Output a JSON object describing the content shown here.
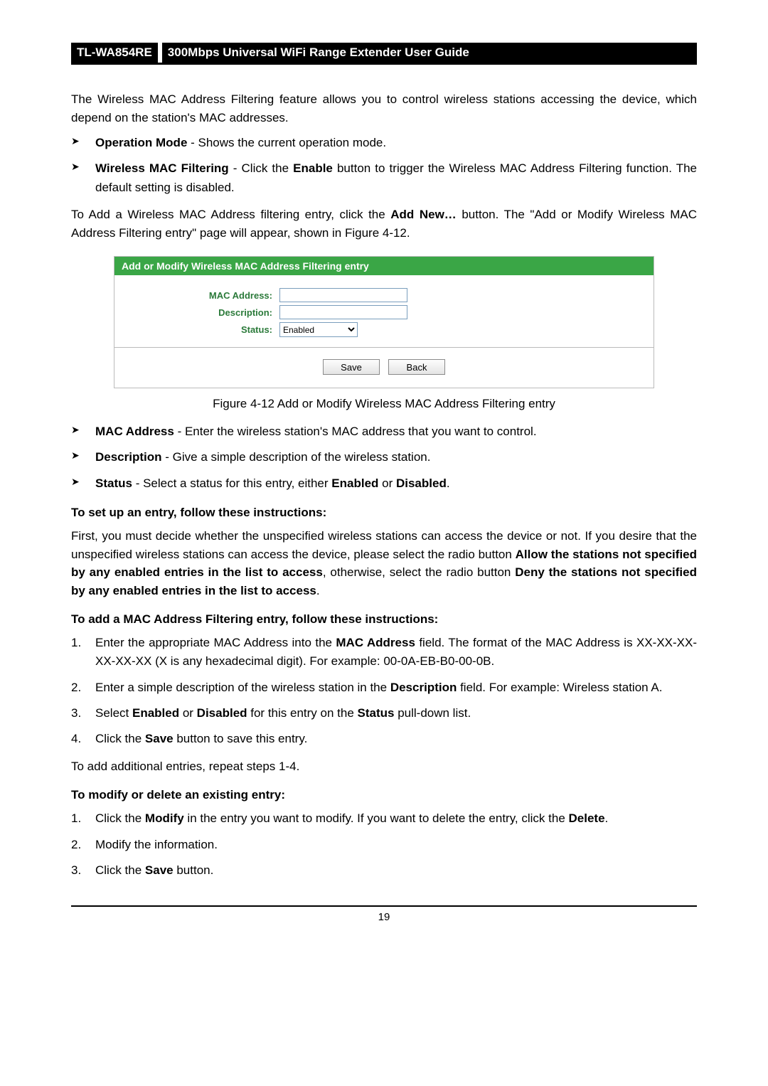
{
  "header": {
    "model": "TL-WA854RE",
    "title": "300Mbps Universal WiFi Range Extender User Guide"
  },
  "intro": "The Wireless MAC Address Filtering feature allows you to control wireless stations accessing the device, which depend on the station's MAC addresses.",
  "bullets1": [
    {
      "label": "Operation Mode",
      "sep": " - ",
      "text": "Shows the current operation mode."
    },
    {
      "label": "Wireless MAC Filtering",
      "sep": " - ",
      "pre": "Click the ",
      "btn": "Enable",
      "post": " button to trigger the Wireless MAC Address Filtering function. The default setting is disabled."
    }
  ],
  "para2_pre": "To Add a Wireless MAC Address filtering entry, click the ",
  "para2_btn": "Add New…",
  "para2_post": " button. The \"Add or Modify Wireless MAC Address Filtering entry\" page will appear, shown in Figure 4-12.",
  "figure": {
    "title": "Add or Modify Wireless MAC Address Filtering entry",
    "mac_label": "MAC Address:",
    "desc_label": "Description:",
    "status_label": "Status:",
    "status_value": "Enabled",
    "save": "Save",
    "back": "Back"
  },
  "figure_caption": "Figure 4-12 Add or Modify Wireless MAC Address Filtering entry",
  "bullets2": [
    {
      "label": "MAC Address",
      "sep": " - ",
      "text": "Enter the wireless station's MAC address that you want to control."
    },
    {
      "label": "Description",
      "sep": " - ",
      "text": "Give a simple description of the wireless station."
    },
    {
      "label": "Status",
      "sep": " - ",
      "pre": "Select a status for this entry, either ",
      "b1": "Enabled",
      "mid": " or ",
      "b2": "Disabled",
      "post": "."
    }
  ],
  "setup_title": "To set up an entry, follow these instructions:",
  "setup_p1": "First, you must decide whether the unspecified wireless stations can access the device or not. If you desire that the unspecified wireless stations can access the device, please select the radio button ",
  "setup_b1": "Allow the stations not specified by any enabled entries in the list to access",
  "setup_mid": ", otherwise, select the radio button ",
  "setup_b2": "Deny the stations not specified by any enabled entries in the list to access",
  "setup_post": ".",
  "add_title": "To add a MAC Address Filtering entry, follow these instructions:",
  "add_steps": {
    "s1_pre": "Enter the appropriate MAC Address into the ",
    "s1_b": "MAC Address",
    "s1_post": " field. The format of the MAC Address is XX-XX-XX-XX-XX-XX (X is any hexadecimal digit). For example: 00-0A-EB-B0-00-0B.",
    "s2_pre": "Enter a simple description of the wireless station in the ",
    "s2_b": "Description",
    "s2_post": " field. For example: Wireless station A.",
    "s3_pre": "Select ",
    "s3_b1": "Enabled",
    "s3_mid1": " or ",
    "s3_b2": "Disabled",
    "s3_mid2": " for this entry on the ",
    "s3_b3": "Status",
    "s3_post": " pull-down list.",
    "s4_pre": "Click the ",
    "s4_b": "Save",
    "s4_post": " button to save this entry."
  },
  "add_repeat": "To add additional entries, repeat steps 1-4.",
  "modify_title": "To modify or delete an existing entry:",
  "modify_steps": {
    "s1_pre": "Click the ",
    "s1_b1": "Modify",
    "s1_mid": " in the entry you want to modify. If you want to delete the entry, click the ",
    "s1_b2": "Delete",
    "s1_post": ".",
    "s2": "Modify the information.",
    "s3_pre": "Click the ",
    "s3_b": "Save",
    "s3_post": " button."
  },
  "page_number": "19"
}
